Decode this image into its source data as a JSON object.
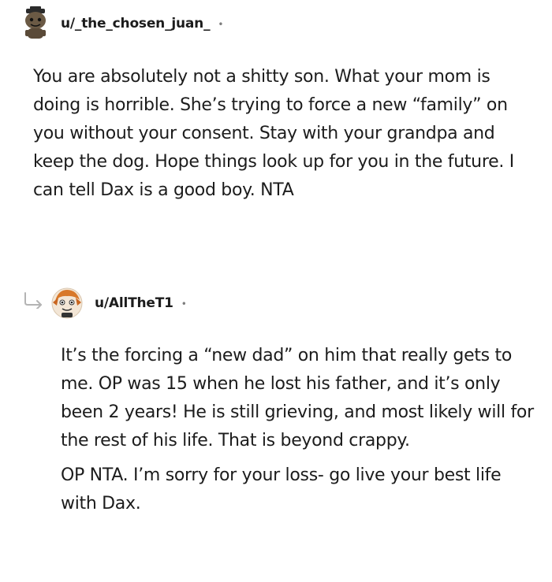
{
  "comment": {
    "username": "u/_the_chosen_juan_",
    "separator": "•",
    "avatar_icon": "snoo-avatar-icon",
    "body": "You are absolutely not a shitty son. What your mom is doing is horrible. She’s trying to force a new “family” on you without your consent. Stay with your grandpa and keep the dog. Hope things look up for you in the future. I can tell Dax is a good boy. NTA"
  },
  "reply": {
    "reply_icon": "reply-arrow-icon",
    "username": "u/AllTheT1",
    "separator": "•",
    "avatar_icon": "snoo-avatar-icon",
    "paragraphs": [
      "It’s the forcing a “new dad” on him that really gets to me. OP was 15 when he lost his father, and it’s only been 2 years! He is still grieving, and most likely will for the rest of his life. That is beyond crappy.",
      "OP NTA. I’m sorry for your loss- go live your best life with Dax."
    ]
  }
}
